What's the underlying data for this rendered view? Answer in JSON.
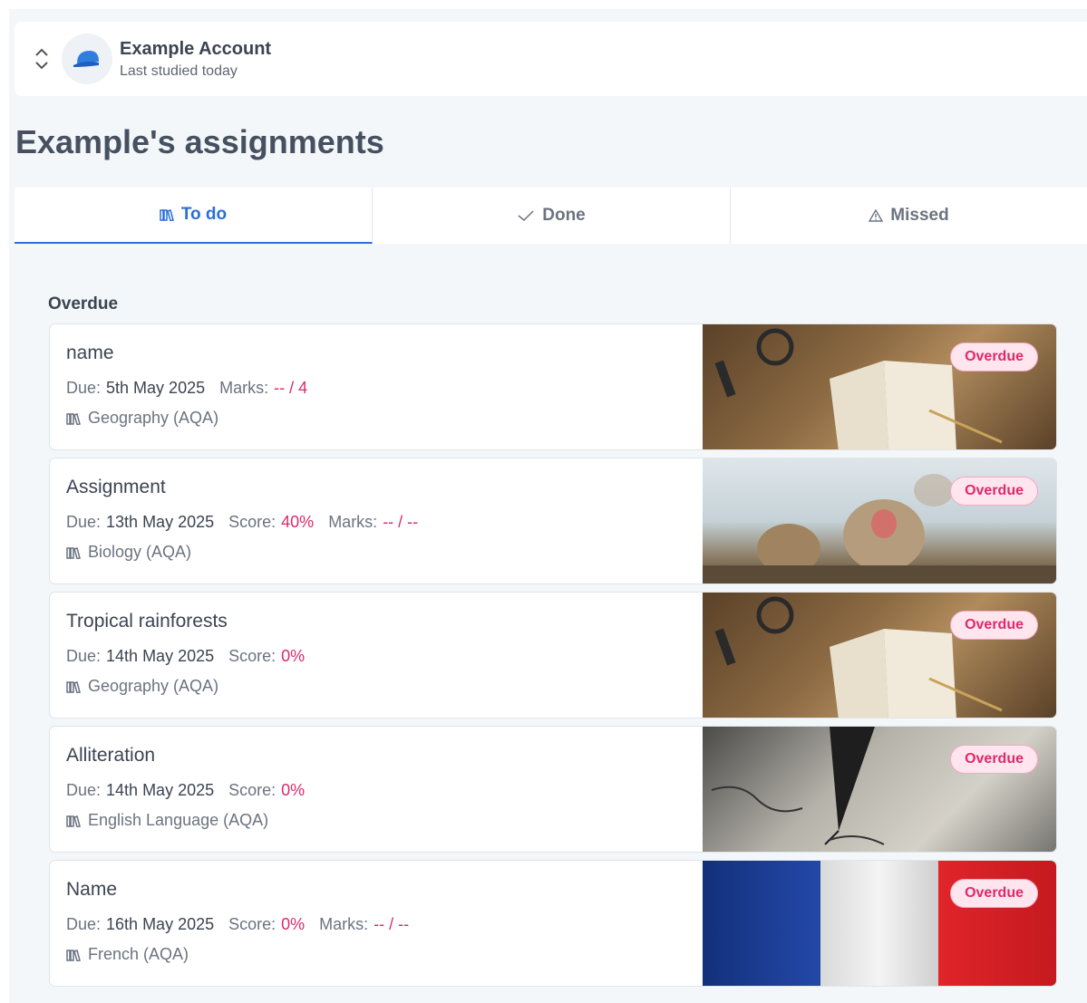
{
  "account": {
    "name": "Example Account",
    "subtitle": "Last studied today"
  },
  "page_title": "Example's assignments",
  "tabs": [
    {
      "label": "To do",
      "icon": "books-icon",
      "active": true
    },
    {
      "label": "Done",
      "icon": "check-icon",
      "active": false
    },
    {
      "label": "Missed",
      "icon": "warning-icon",
      "active": false
    }
  ],
  "section_label": "Overdue",
  "labels": {
    "due": "Due:",
    "score": "Score:",
    "marks": "Marks:"
  },
  "assignments": [
    {
      "title": "name",
      "due": "5th May 2025",
      "score": null,
      "marks": "-- / 4",
      "subject": "Geography (AQA)",
      "badge": "Overdue"
    },
    {
      "title": "Assignment",
      "due": "13th May 2025",
      "score": "40%",
      "marks": "-- / --",
      "subject": "Biology (AQA)",
      "badge": "Overdue"
    },
    {
      "title": "Tropical rainforests",
      "due": "14th May 2025",
      "score": "0%",
      "marks": null,
      "subject": "Geography (AQA)",
      "badge": "Overdue"
    },
    {
      "title": "Alliteration",
      "due": "14th May 2025",
      "score": "0%",
      "marks": null,
      "subject": "English Language (AQA)",
      "badge": "Overdue"
    },
    {
      "title": "Name",
      "due": "16th May 2025",
      "score": "0%",
      "marks": "-- / --",
      "subject": "French (AQA)",
      "badge": "Overdue"
    }
  ],
  "colors": {
    "accent": "#2a6fd6",
    "overdue": "#e0286c"
  }
}
